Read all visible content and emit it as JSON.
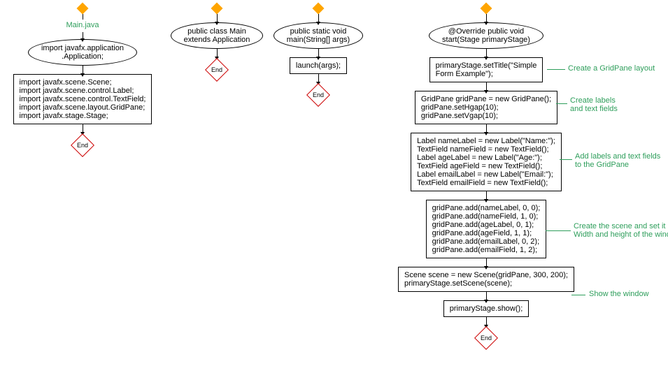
{
  "col1": {
    "label": "Main.java",
    "ellipse": "import javafx.application\n.Application;",
    "box": "import javafx.scene.Scene;\nimport javafx.scene.control.Label;\nimport javafx.scene.control.TextField;\nimport javafx.scene.layout.GridPane;\nimport javafx.stage.Stage;",
    "end": "End"
  },
  "col2": {
    "ellipse": "public class Main\nextends Application",
    "end": "End"
  },
  "col3": {
    "ellipse": "public static void\nmain(String[] args)",
    "box": "launch(args);",
    "end": "End"
  },
  "col4": {
    "ellipse": "@Override public void\nstart(Stage primaryStage)",
    "box1": "primaryStage.setTitle(\"Simple\nForm Example\");",
    "box2": "GridPane gridPane = new GridPane();\ngridPane.setHgap(10);\ngridPane.setVgap(10);",
    "box3": "Label nameLabel = new Label(\"Name:\");\nTextField nameField = new TextField();\nLabel ageLabel = new Label(\"Age:\");\nTextField ageField = new TextField();\nLabel emailLabel = new Label(\"Email:\");\nTextField emailField = new TextField();",
    "box4": "gridPane.add(nameLabel, 0, 0);\ngridPane.add(nameField, 1, 0);\ngridPane.add(ageLabel, 0, 1);\ngridPane.add(ageField, 1, 1);\ngridPane.add(emailLabel, 0, 2);\ngridPane.add(emailField, 1, 2);",
    "box5": "Scene scene = new Scene(gridPane, 300, 200);\nprimaryStage.setScene(scene);",
    "box6": "primaryStage.show();",
    "end": "End"
  },
  "annotations": {
    "a1": "Create a GridPane layout",
    "a2": "Create labels\nand text fields",
    "a3": "Add labels and text fields\nto the GridPane",
    "a4": "Create the scene and set it in the stage\nWidth and height of the window",
    "a5": "Show the window"
  }
}
